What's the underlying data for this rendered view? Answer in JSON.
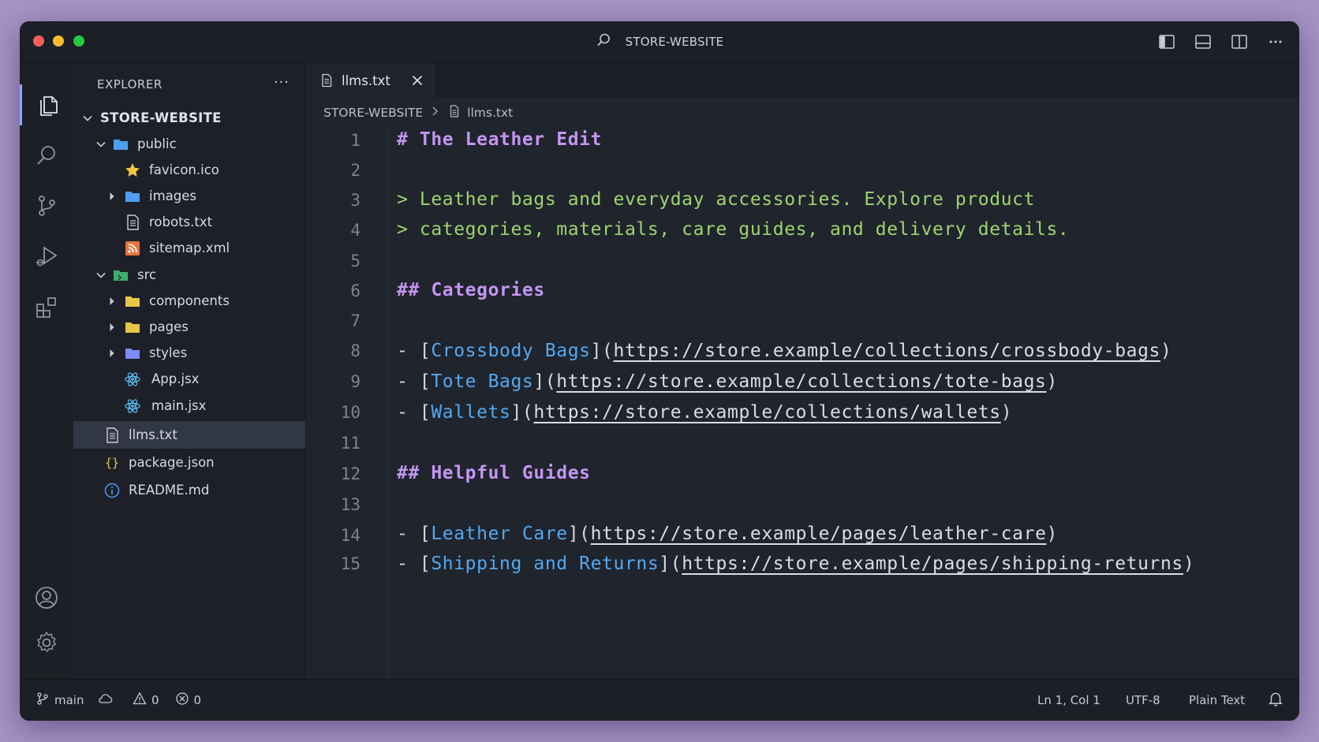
{
  "window": {
    "title": "STORE-WEBSITE"
  },
  "sidebar": {
    "header": "EXPLORER",
    "more": "···",
    "root": "STORE-WEBSITE",
    "items": [
      {
        "label": "public",
        "icon": "folder-icon",
        "kind": "folder-open"
      },
      {
        "label": "favicon.ico",
        "icon": "star-icon",
        "kind": "file"
      },
      {
        "label": "images",
        "icon": "folder-icon",
        "kind": "folder-closed"
      },
      {
        "label": "robots.txt",
        "icon": "text-file-icon",
        "kind": "file"
      },
      {
        "label": "sitemap.xml",
        "icon": "rss-icon",
        "kind": "file"
      },
      {
        "label": "src",
        "icon": "folder-icon",
        "kind": "folder-open"
      },
      {
        "label": "components",
        "icon": "folder-icon",
        "kind": "folder-closed"
      },
      {
        "label": "pages",
        "icon": "folder-icon",
        "kind": "folder-closed"
      },
      {
        "label": "styles",
        "icon": "folder-icon",
        "kind": "folder-closed"
      },
      {
        "label": "App.jsx",
        "icon": "react-icon",
        "kind": "file"
      },
      {
        "label": "main.jsx",
        "icon": "react-icon",
        "kind": "file"
      },
      {
        "label": "llms.txt",
        "icon": "text-file-icon",
        "kind": "file",
        "selected": true
      },
      {
        "label": "package.json",
        "icon": "braces-icon",
        "kind": "file"
      },
      {
        "label": "README.md",
        "icon": "info-icon",
        "kind": "file"
      }
    ]
  },
  "editor": {
    "tab": {
      "label": "llms.txt",
      "icon": "text-file-icon"
    },
    "breadcrumb": {
      "root": "STORE-WEBSITE",
      "file": "llms.txt"
    },
    "line_numbers": [
      "1",
      "2",
      "3",
      "4",
      "5",
      "6",
      "7",
      "8",
      "9",
      "10",
      "11",
      "12",
      "13",
      "14",
      "15"
    ],
    "lines": {
      "l1": "# The Leather Edit",
      "l3": "> Leather bags and everyday accessories. Explore product",
      "l4": "> categories, materials, care guides, and delivery details.",
      "l6": "## Categories",
      "l8": {
        "text": "Crossbody Bags",
        "url": "https://store.example/collections/crossbody-bags"
      },
      "l9": {
        "text": "Tote Bags",
        "url": "https://store.example/collections/tote-bags"
      },
      "l10": {
        "text": "Wallets",
        "url": "https://store.example/collections/wallets"
      },
      "l12": "## Helpful Guides",
      "l14": {
        "text": "Leather Care",
        "url": "https://store.example/pages/leather-care"
      },
      "l15": {
        "text": "Shipping and Returns",
        "url": "https://store.example/pages/shipping-returns"
      }
    }
  },
  "statusbar": {
    "branch": "main",
    "warnings": "0",
    "errors": "0",
    "cursor": "Ln 1, Col 1",
    "encoding": "UTF-8",
    "language": "Plain Text"
  },
  "colors": {
    "background": "#a694c6",
    "heading": "#c495f2",
    "blockquote": "#9fd56c",
    "link_text": "#53a9f1"
  }
}
